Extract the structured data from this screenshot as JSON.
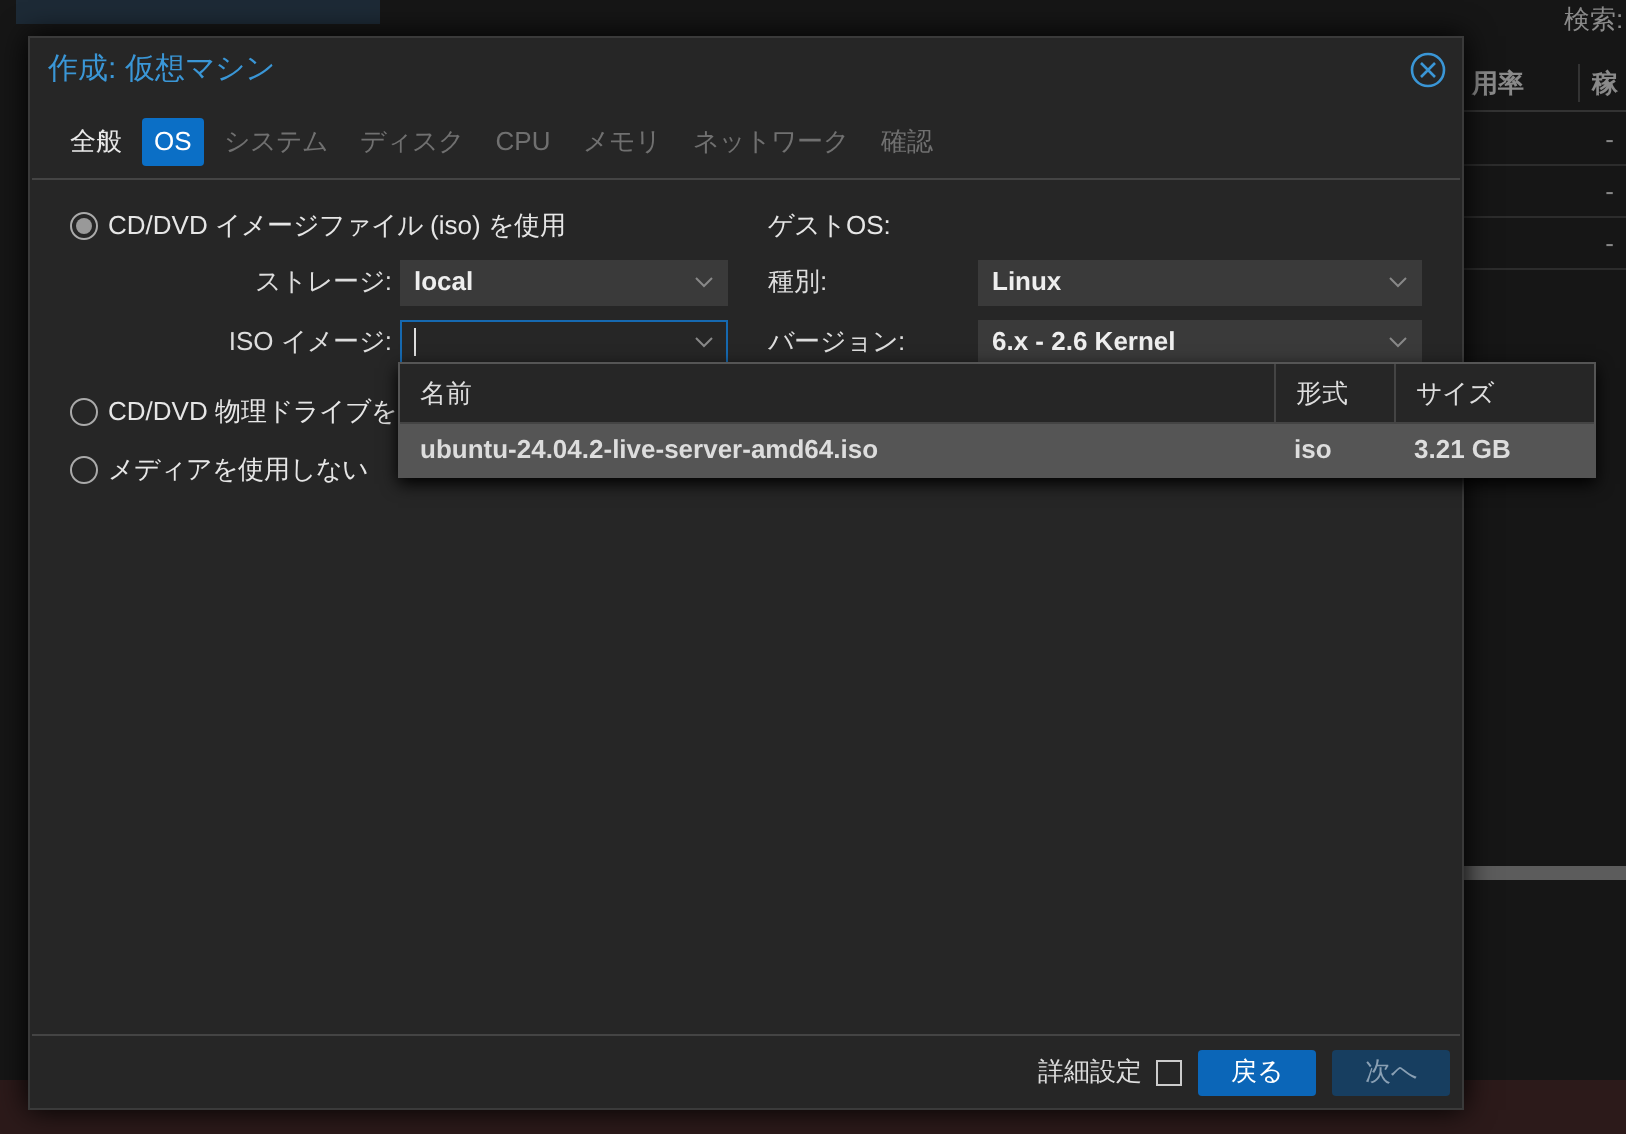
{
  "background": {
    "search_label": "検索:",
    "columns": [
      "用率",
      "稼"
    ],
    "rows": [
      {
        "cell": "-"
      },
      {
        "cell": "-"
      },
      {
        "cell": "-"
      }
    ]
  },
  "dialog": {
    "title": "作成: 仮想マシン",
    "tabs": [
      {
        "label": "全般",
        "selected": false,
        "disabled": false
      },
      {
        "label": "OS",
        "selected": true,
        "disabled": false
      },
      {
        "label": "システム",
        "selected": false,
        "disabled": true
      },
      {
        "label": "ディスク",
        "selected": false,
        "disabled": true
      },
      {
        "label": "CPU",
        "selected": false,
        "disabled": true
      },
      {
        "label": "メモリ",
        "selected": false,
        "disabled": true
      },
      {
        "label": "ネットワーク",
        "selected": false,
        "disabled": true
      },
      {
        "label": "確認",
        "selected": false,
        "disabled": true
      }
    ],
    "media_options": [
      {
        "label": "CD/DVD イメージファイル (iso) を使用",
        "selected": true
      },
      {
        "label": "CD/DVD 物理ドライブを",
        "selected": false
      },
      {
        "label": "メディアを使用しない",
        "selected": false
      }
    ],
    "storage": {
      "label": "ストレージ:",
      "value": "local"
    },
    "iso_image": {
      "label": "ISO イメージ:",
      "focused": true
    },
    "guest_os": {
      "heading": "ゲストOS:",
      "type": {
        "label": "種別:",
        "value": "Linux"
      },
      "version": {
        "label": "バージョン:",
        "value": "6.x - 2.6 Kernel"
      }
    },
    "iso_list": {
      "columns": [
        "名前",
        "形式",
        "サイズ"
      ],
      "rows": [
        {
          "name": "ubuntu-24.04.2-live-server-amd64.iso",
          "format": "iso",
          "size": "3.21 GB",
          "selected": true
        }
      ]
    },
    "footer": {
      "advanced": {
        "label": "詳細設定",
        "checked": false
      },
      "buttons": [
        {
          "label": "戻る",
          "disabled": false
        },
        {
          "label": "次へ",
          "disabled": true
        }
      ]
    }
  }
}
